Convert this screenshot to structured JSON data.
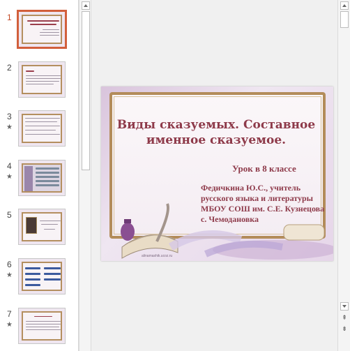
{
  "thumbnails": [
    {
      "number": "1",
      "star": ""
    },
    {
      "number": "2",
      "star": ""
    },
    {
      "number": "3",
      "star": "★"
    },
    {
      "number": "4",
      "star": "★"
    },
    {
      "number": "5",
      "star": ""
    },
    {
      "number": "6",
      "star": "★"
    },
    {
      "number": "7",
      "star": "★"
    }
  ],
  "slide": {
    "title": "Виды сказуемых. Составное именное сказуемое.",
    "subtitle": "Урок в 8 классе",
    "author": "Федичкина Ю.С., учитель русского языка и литературы МБОУ СОШ им. С.Е. Кузнецова с. Чемодановка",
    "url": "alinamashik.ucoz.ru"
  },
  "scrollbar": {
    "nav_prev_icon": "double-up-icon",
    "nav_next_icon": "double-down-icon",
    "nav_prev_glyph": "⇞",
    "nav_next_glyph": "⇟"
  },
  "colors": {
    "selection": "#d25f3c",
    "title_text": "#8e3a4a",
    "frame": "#b38c5a"
  }
}
